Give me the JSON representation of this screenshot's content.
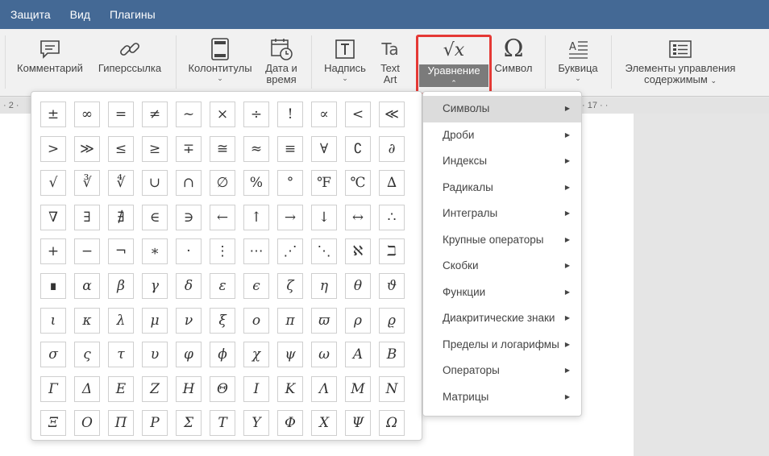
{
  "menu_tabs": [
    "Защита",
    "Вид",
    "Плагины"
  ],
  "ribbon": {
    "comment": "Комментарий",
    "hyperlink": "Гиперссылка",
    "headers_footers": "Колонтитулы",
    "date_time_1": "Дата и",
    "date_time_2": "время",
    "text_box": "Надпись",
    "text_art_1": "Text",
    "text_art_2": "Art",
    "equation": "Уравнение",
    "symbol": "Символ",
    "drop_cap": "Буквица",
    "content_controls_1": "Элементы управления",
    "content_controls_2": "содержимым"
  },
  "ruler": {
    "left": "2",
    "right": "17"
  },
  "symbols": [
    "±",
    "∞",
    "=",
    "≠",
    "~",
    "×",
    "÷",
    "!",
    "∝",
    "<",
    "≪",
    ">",
    "≫",
    "≤",
    "≥",
    "∓",
    "≅",
    "≈",
    "≡",
    "∀",
    "∁",
    "∂",
    "√",
    "∛",
    "∜",
    "∪",
    "∩",
    "∅",
    "%",
    "°",
    "℉",
    "℃",
    "∆",
    "∇",
    "∃",
    "∄",
    "∈",
    "∋",
    "←",
    "↑",
    "→",
    "↓",
    "↔",
    "∴",
    "+",
    "−",
    "¬",
    "∗",
    "·",
    "⋮",
    "⋯",
    "⋰",
    "⋱",
    "ℵ",
    "ℶ",
    "∎",
    "α",
    "β",
    "γ",
    "δ",
    "ε",
    "ϵ",
    "ζ",
    "η",
    "θ",
    "ϑ",
    "ι",
    "κ",
    "λ",
    "μ",
    "ν",
    "ξ",
    "ο",
    "π",
    "ϖ",
    "ρ",
    "ϱ",
    "σ",
    "ς",
    "τ",
    "υ",
    "φ",
    "ϕ",
    "χ",
    "ψ",
    "ω",
    "Α",
    "Β",
    "Γ",
    "Δ",
    "Ε",
    "Ζ",
    "Η",
    "Θ",
    "Ι",
    "Κ",
    "Λ",
    "Μ",
    "Ν",
    "Ξ",
    "Ο",
    "Π",
    "Ρ",
    "Σ",
    "Τ",
    "Υ",
    "Φ",
    "Χ",
    "Ψ",
    "Ω"
  ],
  "submenu": [
    "Символы",
    "Дроби",
    "Индексы",
    "Радикалы",
    "Интегралы",
    "Крупные операторы",
    "Скобки",
    "Функции",
    "Диакритические знаки",
    "Пределы и логарифмы",
    "Операторы",
    "Матрицы"
  ],
  "submenu_active_index": 0,
  "colors": {
    "titlebar": "#446995",
    "highlight": "#e53935",
    "active_button": "#7b7b7b"
  }
}
